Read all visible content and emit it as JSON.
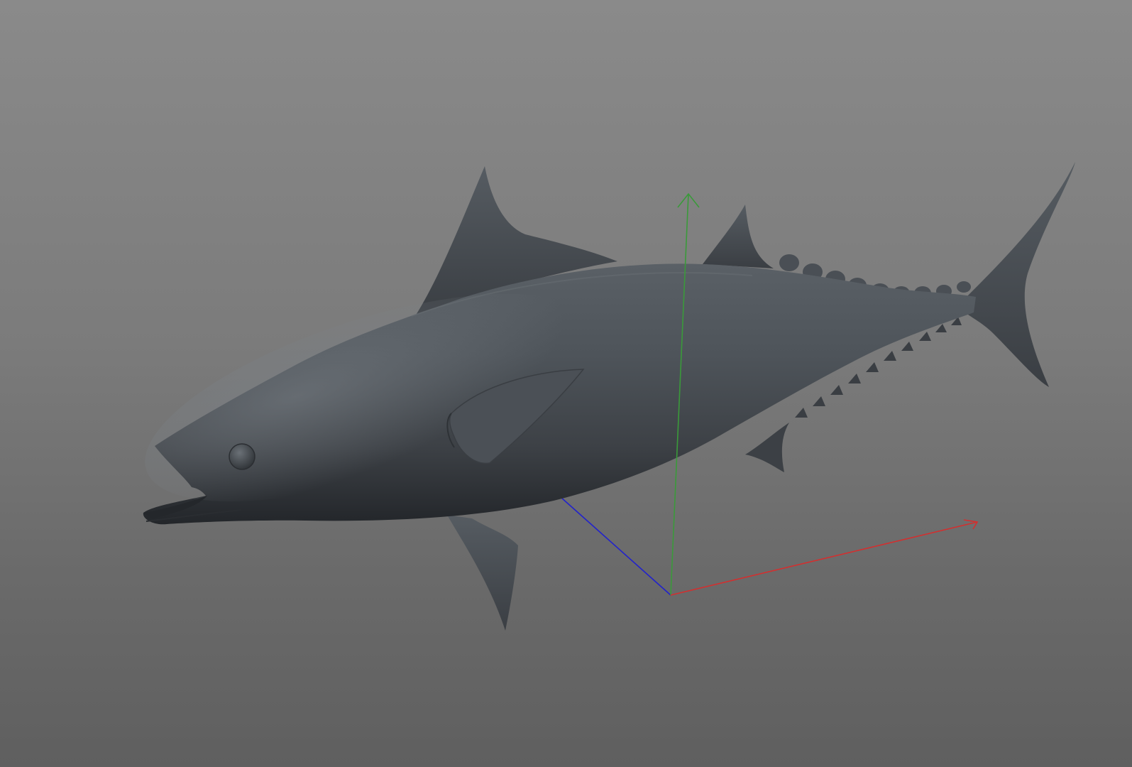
{
  "viewport": {
    "background_top": "#8a8a8a",
    "background_bottom": "#5f5f5f"
  },
  "model": {
    "name": "tuna-mesh",
    "shading": "gray matcap",
    "color": "#4a4e53"
  },
  "gizmo": {
    "x_axis_color": "#d32f2f",
    "y_axis_color": "#3a9a3a",
    "z_axis_color": "#2222cc"
  }
}
